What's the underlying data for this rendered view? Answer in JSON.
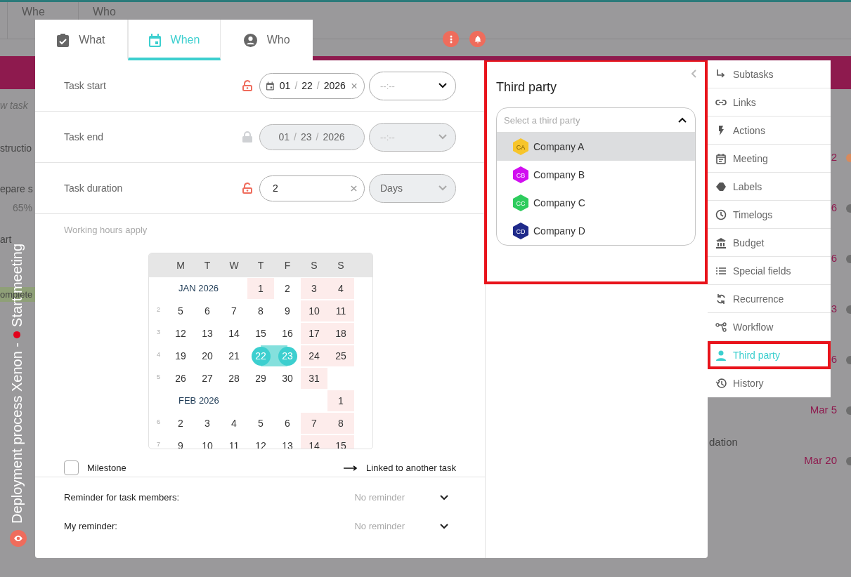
{
  "background": {
    "top_tabs": [
      "Whe",
      "Who"
    ],
    "left_rows": [
      {
        "text": "w task",
        "kind": "hint"
      },
      {
        "text": "structio",
        "kind": "title"
      },
      {
        "text": "epare s",
        "kind": "title"
      },
      {
        "text": "65%",
        "kind": "progress"
      },
      {
        "text": "art",
        "kind": "title"
      },
      {
        "text": "omplete",
        "kind": "status"
      }
    ],
    "right_rows": [
      {
        "text": "2",
        "color": "#d98a5c"
      },
      {
        "text": "6",
        "color": "#6e6e6e"
      },
      {
        "text": "6",
        "color": "#6e6e6e"
      },
      {
        "text": "3",
        "color": "#6e6e6e"
      },
      {
        "text": "6",
        "color": "#6e6e6e"
      },
      {
        "text": "Mar 5",
        "color": "#6e6e6e"
      },
      {
        "text": "dation",
        "color": ""
      },
      {
        "text": "Mar 20",
        "color": "#6e6e6e"
      }
    ],
    "banner": {
      "title": "Deployment process Xenon -",
      "subtitle": "Start meeting"
    }
  },
  "tabs": [
    {
      "label": "What",
      "selected": false
    },
    {
      "label": "When",
      "selected": true
    },
    {
      "label": "Who",
      "selected": false
    }
  ],
  "fields": [
    {
      "label": "Task start",
      "kind": "date",
      "locked": false,
      "disabled": false,
      "clearable": true,
      "parts": [
        "01",
        "22",
        "2026"
      ],
      "separator": "/",
      "select": {
        "placeholder": "--:--",
        "disabled": false
      }
    },
    {
      "label": "Task end",
      "kind": "date",
      "locked": true,
      "disabled": true,
      "clearable": false,
      "parts": [
        "01",
        "23",
        "2026"
      ],
      "separator": "/",
      "select": {
        "placeholder": "--:--",
        "disabled": true
      }
    },
    {
      "label": "Task duration",
      "kind": "number",
      "locked": false,
      "disabled": false,
      "clearable": true,
      "value": "2",
      "select": {
        "value": "Days",
        "disabled": true
      }
    }
  ],
  "working_hours_note": "Working hours apply",
  "calendar": {
    "weekdays": [
      "M",
      "T",
      "W",
      "T",
      "F",
      "S",
      "S"
    ],
    "rows": [
      {
        "week": "",
        "month": "JAN 2026",
        "days": [
          {
            "d": "1",
            "shaded": true,
            "selected": false
          },
          {
            "d": "2",
            "shaded": false,
            "selected": false
          },
          {
            "d": "3",
            "shaded": true,
            "selected": false
          },
          {
            "d": "4",
            "shaded": true,
            "selected": false
          }
        ]
      },
      {
        "week": "2",
        "days": [
          {
            "d": "5",
            "shaded": false,
            "selected": false
          },
          {
            "d": "6",
            "shaded": false,
            "selected": false
          },
          {
            "d": "7",
            "shaded": false,
            "selected": false
          },
          {
            "d": "8",
            "shaded": false,
            "selected": false
          },
          {
            "d": "9",
            "shaded": false,
            "selected": false
          },
          {
            "d": "10",
            "shaded": true,
            "selected": false
          },
          {
            "d": "11",
            "shaded": true,
            "selected": false
          }
        ]
      },
      {
        "week": "3",
        "days": [
          {
            "d": "12",
            "shaded": false,
            "selected": false
          },
          {
            "d": "13",
            "shaded": false,
            "selected": false
          },
          {
            "d": "14",
            "shaded": false,
            "selected": false
          },
          {
            "d": "15",
            "shaded": false,
            "selected": false
          },
          {
            "d": "16",
            "shaded": false,
            "selected": false
          },
          {
            "d": "17",
            "shaded": true,
            "selected": false
          },
          {
            "d": "18",
            "shaded": true,
            "selected": false
          }
        ]
      },
      {
        "week": "4",
        "days": [
          {
            "d": "19",
            "shaded": false,
            "selected": false
          },
          {
            "d": "20",
            "shaded": false,
            "selected": false
          },
          {
            "d": "21",
            "shaded": false,
            "selected": false
          },
          {
            "d": "22",
            "shaded": false,
            "selected": true
          },
          {
            "d": "23",
            "shaded": false,
            "selected": true
          },
          {
            "d": "24",
            "shaded": true,
            "selected": false
          },
          {
            "d": "25",
            "shaded": true,
            "selected": false
          }
        ]
      },
      {
        "week": "5",
        "days": [
          {
            "d": "26",
            "shaded": false,
            "selected": false
          },
          {
            "d": "27",
            "shaded": false,
            "selected": false
          },
          {
            "d": "28",
            "shaded": false,
            "selected": false
          },
          {
            "d": "29",
            "shaded": false,
            "selected": false
          },
          {
            "d": "30",
            "shaded": false,
            "selected": false
          },
          {
            "d": "31",
            "shaded": true,
            "selected": false
          }
        ]
      },
      {
        "week": "",
        "month": "FEB 2026",
        "days": [
          {
            "d": "1",
            "shaded": true,
            "selected": false
          }
        ]
      },
      {
        "week": "6",
        "days": [
          {
            "d": "2",
            "shaded": false,
            "selected": false
          },
          {
            "d": "3",
            "shaded": false,
            "selected": false
          },
          {
            "d": "4",
            "shaded": false,
            "selected": false
          },
          {
            "d": "5",
            "shaded": false,
            "selected": false
          },
          {
            "d": "6",
            "shaded": false,
            "selected": false
          },
          {
            "d": "7",
            "shaded": true,
            "selected": false
          },
          {
            "d": "8",
            "shaded": true,
            "selected": false
          }
        ]
      },
      {
        "week": "7",
        "days": [
          {
            "d": "9",
            "shaded": false,
            "selected": false
          },
          {
            "d": "10",
            "shaded": false,
            "selected": false
          },
          {
            "d": "11",
            "shaded": false,
            "selected": false
          },
          {
            "d": "12",
            "shaded": false,
            "selected": false
          },
          {
            "d": "13",
            "shaded": false,
            "selected": false
          },
          {
            "d": "14",
            "shaded": true,
            "selected": false
          },
          {
            "d": "15",
            "shaded": true,
            "selected": false
          }
        ]
      }
    ]
  },
  "milestone": {
    "label": "Milestone",
    "checked": false
  },
  "linked_label": "Linked to another task",
  "reminders": [
    {
      "label": "Reminder for task members:",
      "placeholder": "No reminder"
    },
    {
      "label": "My reminder:",
      "placeholder": "No reminder"
    }
  ],
  "third_party": {
    "title": "Third party",
    "placeholder": "Select a third party",
    "expanded": true,
    "options": [
      {
        "initials": "CA",
        "name": "Company A",
        "color": "#f7c52b",
        "selected": true
      },
      {
        "initials": "CB",
        "name": "Company B",
        "color": "#d10ff0",
        "selected": false
      },
      {
        "initials": "CC",
        "name": "Company C",
        "color": "#2ecc5e",
        "selected": false
      },
      {
        "initials": "CD",
        "name": "Company D",
        "color": "#1f2a8a",
        "selected": false
      }
    ]
  },
  "side_menu": [
    {
      "label": "Subtasks",
      "selected": false
    },
    {
      "label": "Links",
      "selected": false
    },
    {
      "label": "Actions",
      "selected": false
    },
    {
      "label": "Meeting",
      "selected": false
    },
    {
      "label": "Labels",
      "selected": false
    },
    {
      "label": "Timelogs",
      "selected": false
    },
    {
      "label": "Budget",
      "selected": false
    },
    {
      "label": "Special fields",
      "selected": false
    },
    {
      "label": "Recurrence",
      "selected": false
    },
    {
      "label": "Workflow",
      "selected": false
    },
    {
      "label": "Third party",
      "selected": true
    },
    {
      "label": "History",
      "selected": false
    }
  ]
}
